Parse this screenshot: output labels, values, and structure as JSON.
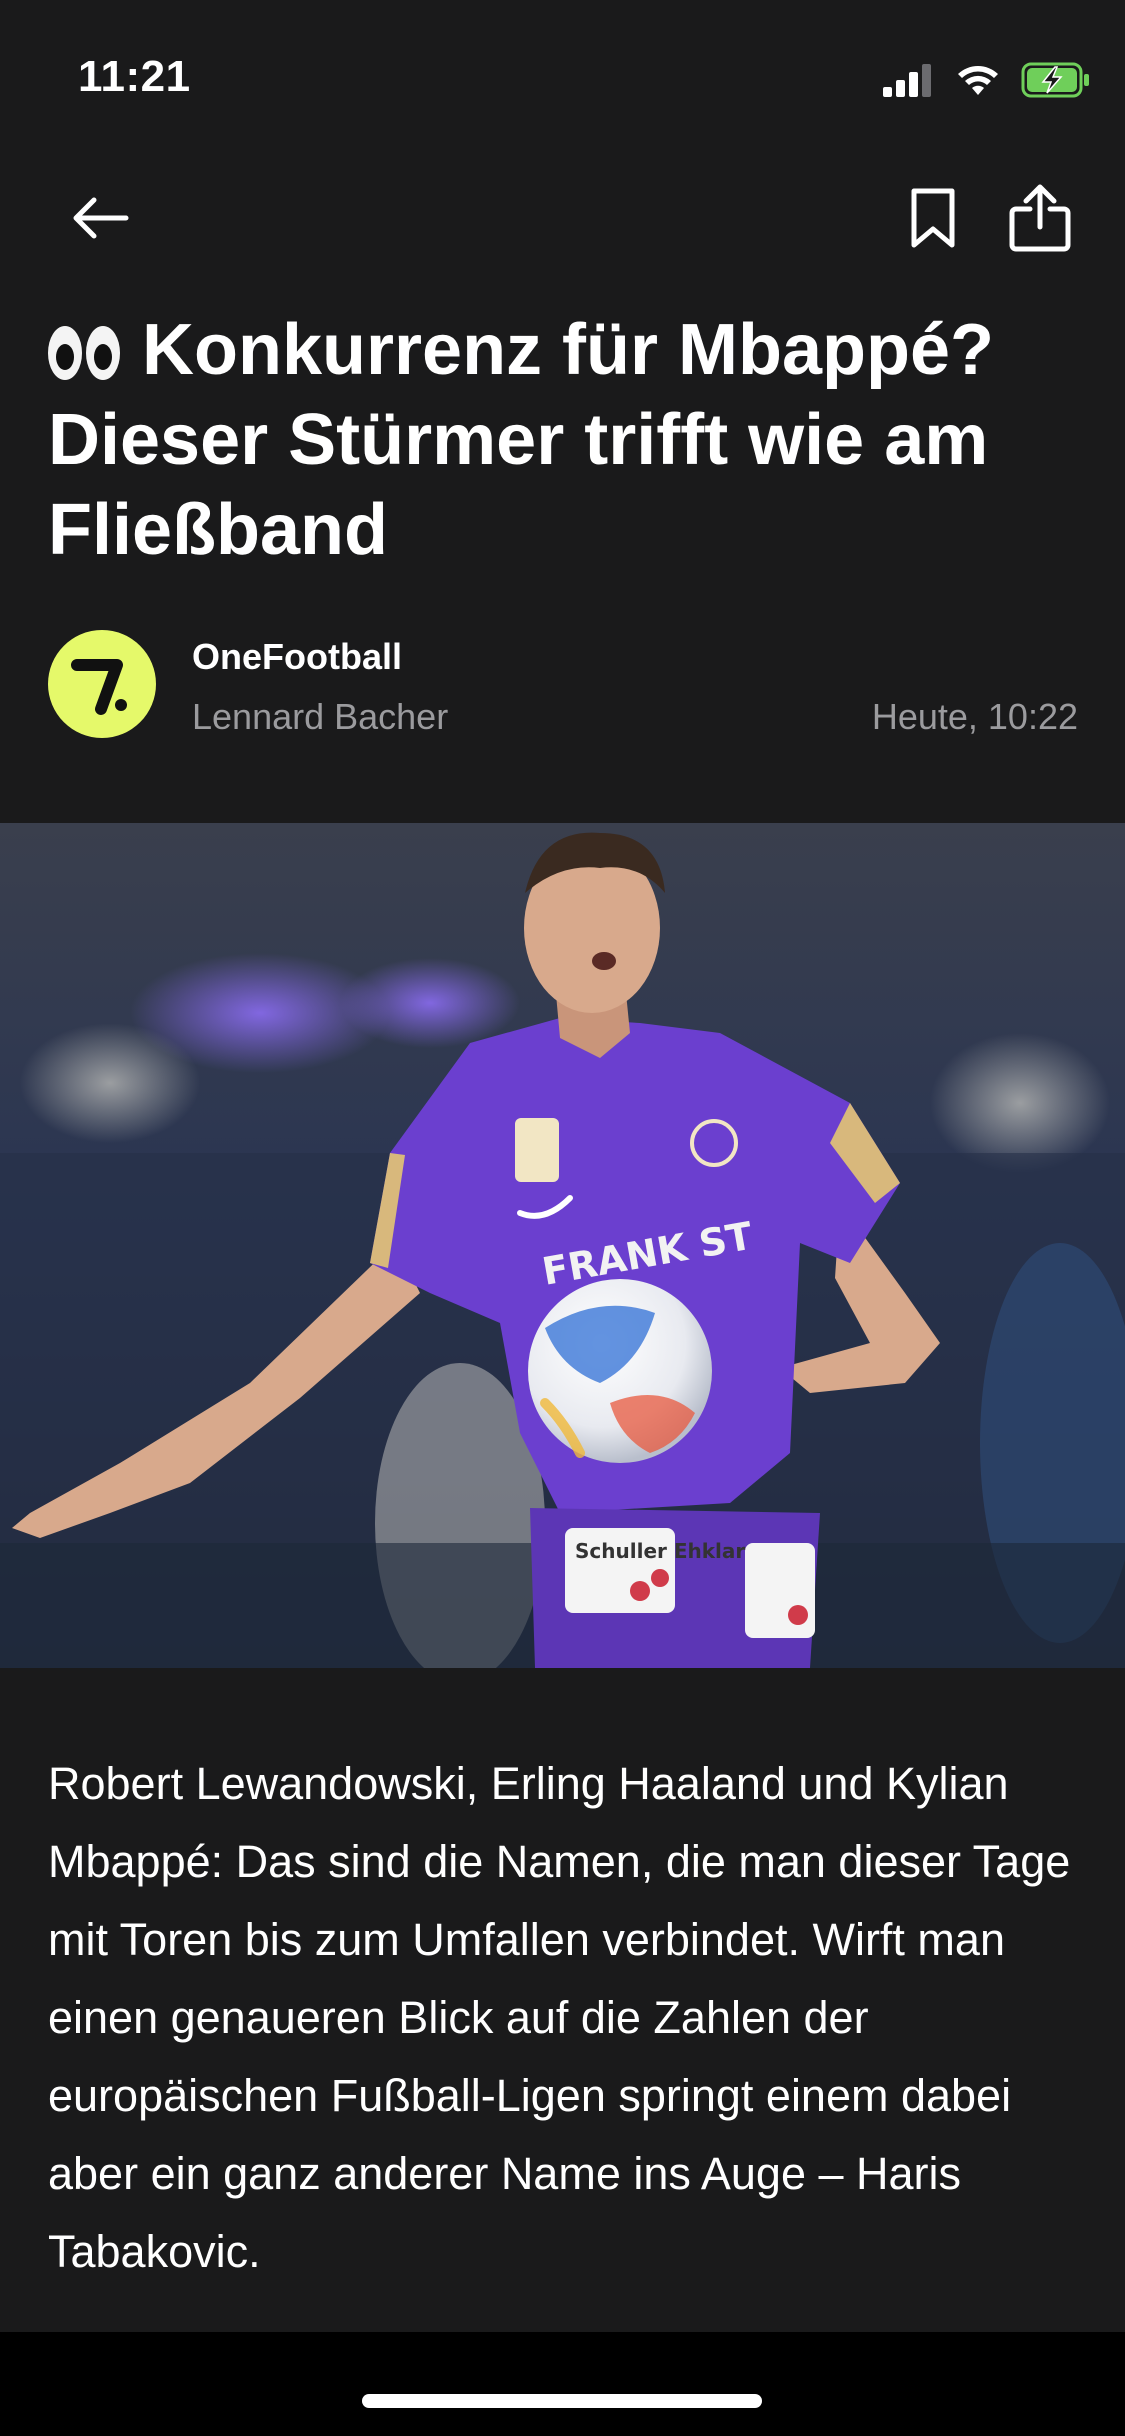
{
  "status_bar": {
    "time": "11:21"
  },
  "nav": {
    "back_icon": "arrow-left-icon",
    "bookmark_icon": "bookmark-icon",
    "share_icon": "share-icon"
  },
  "article": {
    "emoji": "👀",
    "headline": "Konkurrenz für Mbappé? Dieser Stürmer trifft wie am Fließband",
    "publisher": "OneFootball",
    "author": "Lennard Bacher",
    "published": "Heute, 10:22",
    "body": "Robert Lewandowski, Erling Haaland und Kylian Mbappé: Das sind die Namen, die man dieser Tage mit Toren bis zum Umfallen verbindet. Wirft man einen genaueren Blick auf die Zahlen der europäischen Fußball-Ligen springt einem dabei aber ein ganz anderer Name ins Auge – Haris Tabakovic."
  },
  "hero_image": {
    "jersey_text": "FRANK ST",
    "shorts_text": "Schuller Ehklar"
  },
  "colors": {
    "background": "#1a1a1b",
    "text_primary": "#ffffff",
    "text_secondary": "#9b9b9e",
    "logo_accent": "#e5f96a",
    "jersey_purple": "#6b3fcf"
  }
}
